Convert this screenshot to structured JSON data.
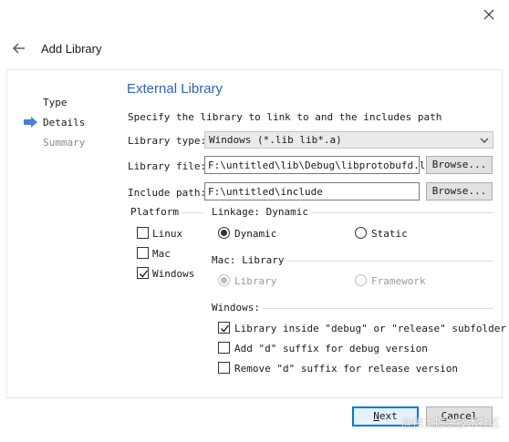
{
  "window": {
    "title": "Add Library",
    "close_icon": "close-icon",
    "back_icon": "back-arrow-icon"
  },
  "steps": [
    {
      "label": "Type",
      "state": "done"
    },
    {
      "label": "Details",
      "state": "current"
    },
    {
      "label": "Summary",
      "state": "pending"
    }
  ],
  "page": {
    "title": "External Library",
    "description": "Specify the library to link to and the includes path"
  },
  "form": {
    "library_type_label": "Library type:",
    "library_type_value": "Windows (*.lib lib*.a)",
    "library_file_label": "Library file:",
    "library_file_value": "F:\\untitled\\lib\\Debug\\libprotobufd.lib",
    "include_path_label": "Include path:",
    "include_path_value": "F:\\untitled\\include",
    "browse_label": "Browse..."
  },
  "platform": {
    "label": "Platform",
    "items": [
      {
        "label": "Linux",
        "checked": false
      },
      {
        "label": "Mac",
        "checked": false
      },
      {
        "label": "Windows",
        "checked": true
      }
    ]
  },
  "linkage": {
    "label": "Linkage: Dynamic",
    "options": [
      {
        "label": "Dynamic",
        "selected": true
      },
      {
        "label": "Static",
        "selected": false
      }
    ]
  },
  "mac": {
    "label": "Mac: Library",
    "options": [
      {
        "label": "Library",
        "selected": true,
        "disabled": true
      },
      {
        "label": "Framework",
        "selected": false,
        "disabled": true
      }
    ]
  },
  "windows": {
    "label": "Windows:",
    "options": [
      {
        "label": "Library inside \"debug\" or \"release\" subfolder",
        "checked": true
      },
      {
        "label": "Add \"d\" suffix for debug version",
        "checked": false
      },
      {
        "label": "Remove \"d\" suffix for release version",
        "checked": false
      }
    ]
  },
  "buttons": {
    "next_rest": "ext",
    "next_mnemonic": "N",
    "cancel_rest": "ancel",
    "cancel_mnemonic": "C"
  },
  "watermark": "@稀土掘金技术社区",
  "colors": {
    "accent": "#2d64b3",
    "focus_border": "#0078d7",
    "step_arrow": "#4a7fd4"
  }
}
